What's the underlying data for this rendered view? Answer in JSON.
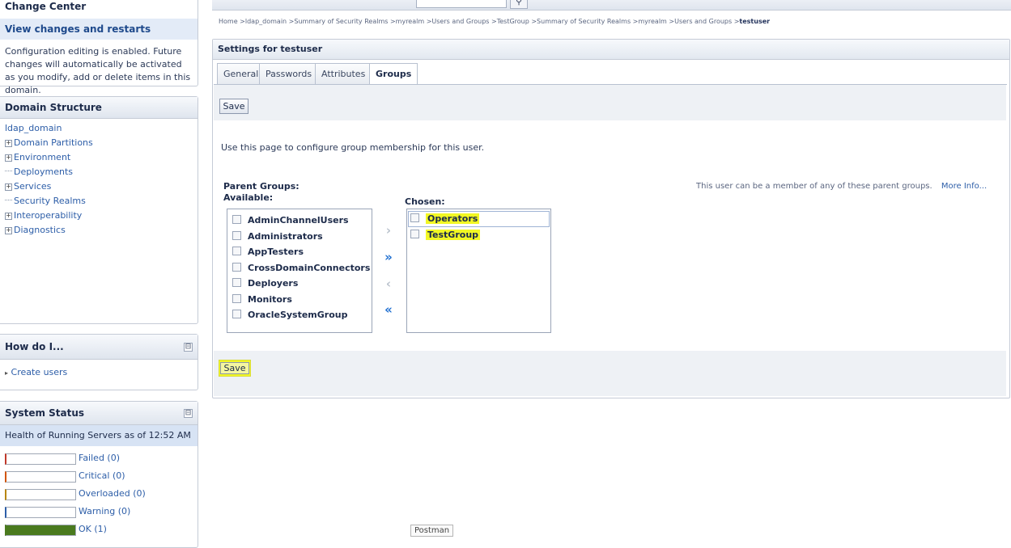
{
  "change_center": {
    "title": "Change Center",
    "view_changes_link": "View changes and restarts",
    "description": "Configuration editing is enabled. Future changes will automatically be activated as you modify, add or delete items in this domain."
  },
  "domain_structure": {
    "title": "Domain Structure",
    "items": [
      {
        "label": "ldap_domain"
      },
      {
        "label": "Domain Partitions"
      },
      {
        "label": "Environment"
      },
      {
        "label": "Deployments"
      },
      {
        "label": "Services"
      },
      {
        "label": "Security Realms"
      },
      {
        "label": "Interoperability"
      },
      {
        "label": "Diagnostics"
      }
    ]
  },
  "how_do_i": {
    "title": "How do I...",
    "links": [
      "Create users"
    ]
  },
  "system_status": {
    "title": "System Status",
    "health_title": "Health of Running Servers as of  12:52 AM",
    "rows": [
      {
        "label": "Failed (0)",
        "fill": 0,
        "color": "#c0392b"
      },
      {
        "label": "Critical (0)",
        "fill": 0,
        "color": "#d35400"
      },
      {
        "label": "Overloaded (0)",
        "fill": 0,
        "color": "#b8860b"
      },
      {
        "label": "Warning (0)",
        "fill": 0,
        "color": "#2d5ea8"
      },
      {
        "label": "OK (1)",
        "fill": 1.0,
        "color": "#4a7a1e"
      }
    ]
  },
  "breadcrumb": "Home >ldap_domain >Summary of Security Realms >myrealm >Users and Groups >TestGroup >Summary of Security Realms >myrealm >Users and Groups >",
  "breadcrumb_current": "testuser",
  "settings": {
    "title": "Settings for testuser",
    "tabs": [
      {
        "label": "General"
      },
      {
        "label": "Passwords"
      },
      {
        "label": "Attributes"
      },
      {
        "label": "Groups"
      }
    ],
    "active_tab": "Groups",
    "save_label": "Save",
    "description": "Use this page to configure group membership for this user.",
    "parent_groups_label": "Parent Groups:",
    "available_label": "Available:",
    "chosen_label": "Chosen:",
    "available": [
      "AdminChannelUsers",
      "Administrators",
      "AppTesters",
      "CrossDomainConnectors",
      "Deployers",
      "Monitors",
      "OracleSystemGroup"
    ],
    "chosen": [
      "Operators",
      "TestGroup"
    ],
    "help_text": "This user can be a member of any of these parent groups.",
    "more_info": "More Info...",
    "highlight_color": "#f2f724"
  },
  "tooltip": "Postman",
  "icons": {
    "move_right": "chevron-right-icon",
    "move_all_right": "double-chevron-right-icon",
    "move_left": "chevron-left-icon",
    "move_all_left": "double-chevron-left-icon",
    "collapse": "collapse-box-icon"
  }
}
